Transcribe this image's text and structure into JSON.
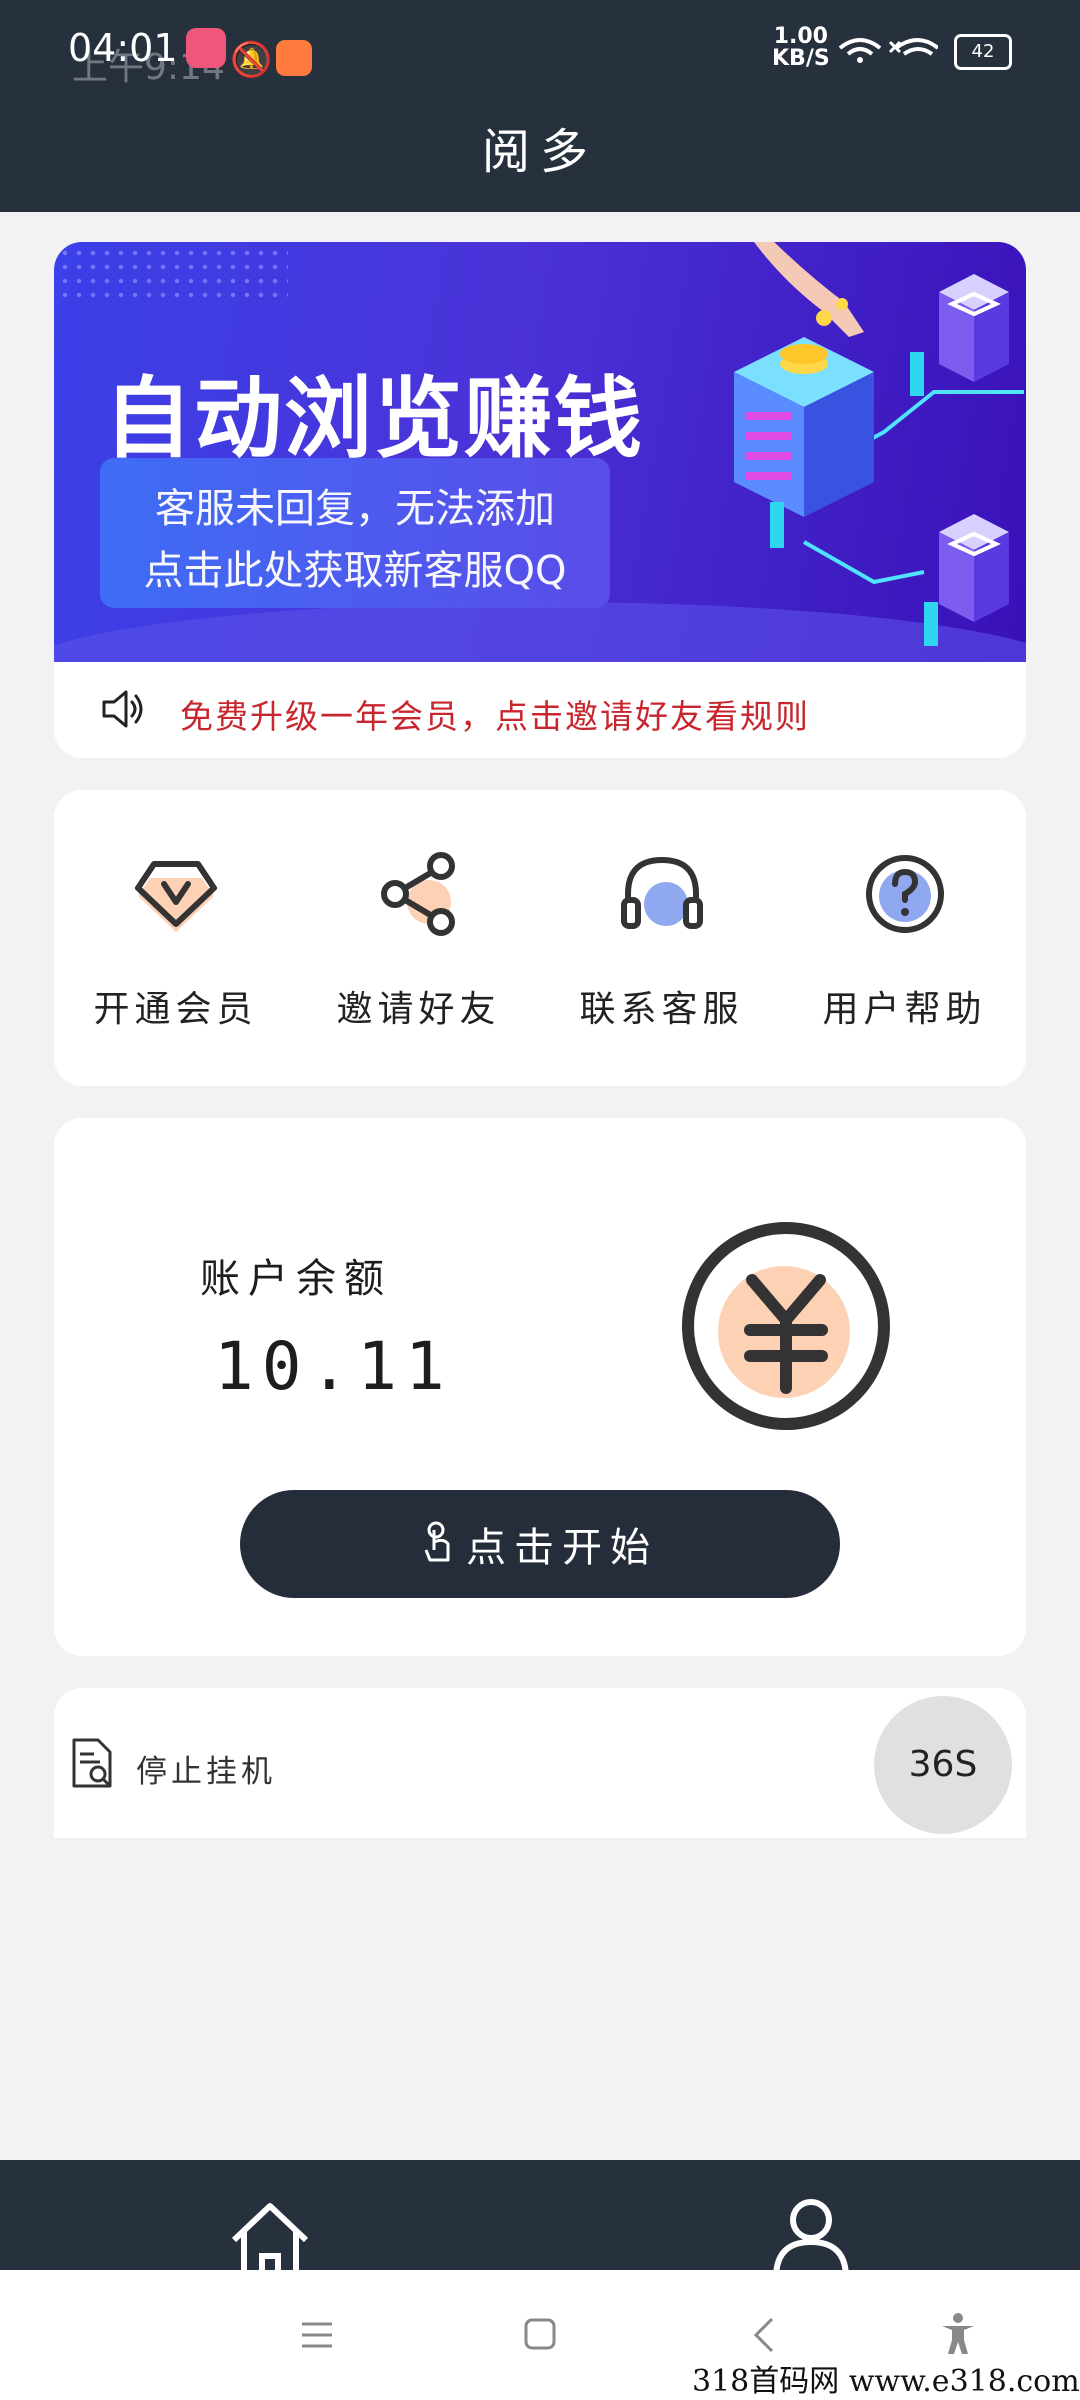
{
  "status_bar": {
    "time": "04:01",
    "time_overlay": "上午9:14",
    "net_speed_value": "1.00",
    "net_speed_unit": "KB/S",
    "battery": "42"
  },
  "header": {
    "title": "阅多"
  },
  "banner": {
    "headline": "自动浏览赚钱",
    "line1": "客服未回复，无法添加",
    "line2": "点击此处获取新客服QQ"
  },
  "notice": {
    "text": "免费升级一年会员，点击邀请好友看规则"
  },
  "menu": [
    {
      "label": "开通会员",
      "icon": "vip-diamond-icon"
    },
    {
      "label": "邀请好友",
      "icon": "share-icon"
    },
    {
      "label": "联系客服",
      "icon": "headset-icon"
    },
    {
      "label": "用户帮助",
      "icon": "help-icon"
    }
  ],
  "account": {
    "balance_label": "账户余额",
    "balance_value": "10.11",
    "start_label": "点击开始"
  },
  "task": {
    "label": "停止挂机",
    "timer": "36S"
  },
  "watermark": "318首码网 www.e318.com",
  "colors": {
    "header": "#27303d",
    "accent_orange": "#fcd1b4",
    "accent_blue": "#8fa8f0",
    "notice_red": "#c8262e"
  }
}
